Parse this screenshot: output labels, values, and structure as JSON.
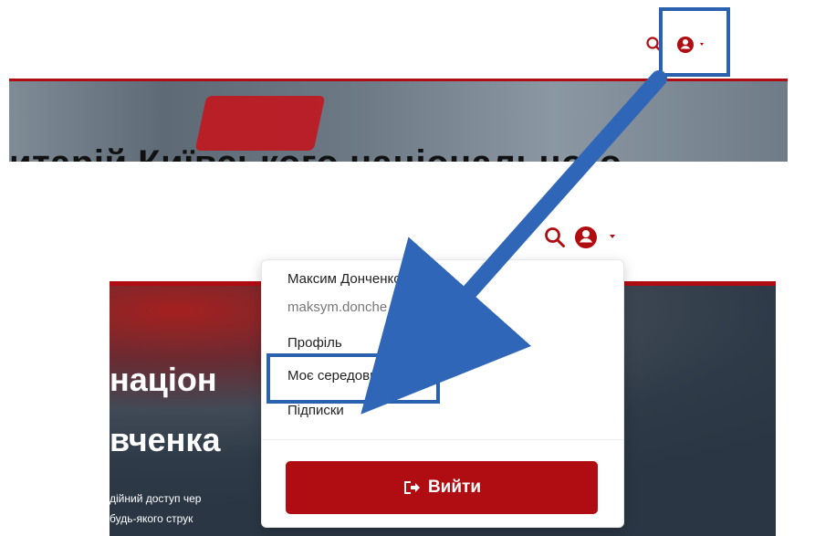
{
  "colors": {
    "accent_red": "#b00d12",
    "highlight_blue": "#2a62b0"
  },
  "top": {
    "banner_text": "итарій Київського національного",
    "icons": {
      "search": "search-icon",
      "user": "user-circle-icon",
      "caret": "caret-down-icon"
    }
  },
  "bottom": {
    "headline_line1": "націон",
    "headline_line2": "вченка",
    "body_line1": "дійний доступ чер",
    "body_line2": "будь-якого струк",
    "icons": {
      "search": "search-icon",
      "user": "user-circle-icon",
      "caret": "caret-down-icon"
    }
  },
  "menu": {
    "user_name": "Максим Донченко",
    "user_email": "maksym.donche  @knu.ua",
    "items": [
      {
        "label": "Профіль"
      },
      {
        "label": "Моє середовище"
      },
      {
        "label": "Підписки"
      }
    ],
    "logout_label": "Вийти",
    "logout_icon": "sign-out-icon"
  }
}
